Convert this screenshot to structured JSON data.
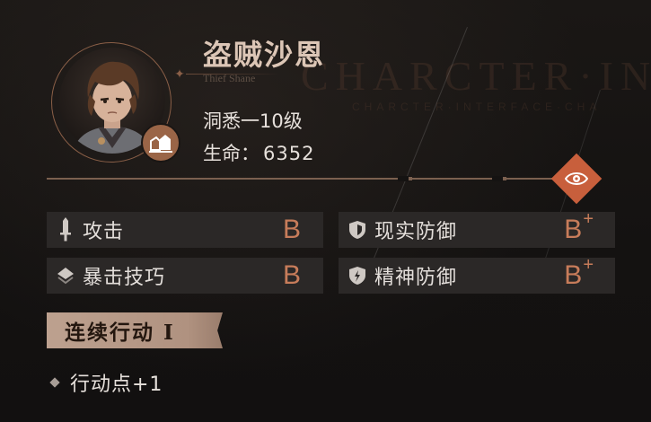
{
  "watermark": {
    "title": "CHARCTER·IN",
    "subtitle": "CHARCTER·INTERFACE·CHA"
  },
  "character": {
    "name": "盗贼沙恩",
    "name_en": "Thief Shane",
    "insight_level": "洞悉一10级",
    "life_label": "生命：",
    "life_value": "6352",
    "class_icon": "thief-class-icon"
  },
  "view_button": {
    "icon": "eye-icon",
    "color": "#c85f3c"
  },
  "stats": [
    {
      "icon": "sword-icon",
      "label": "攻击",
      "grade": "B",
      "plus": ""
    },
    {
      "icon": "shield-icon",
      "label": "现实防御",
      "grade": "B",
      "plus": "+"
    },
    {
      "icon": "diamond-layers-icon",
      "label": "暴击技巧",
      "grade": "B",
      "plus": ""
    },
    {
      "icon": "mind-shield-icon",
      "label": "精神防御",
      "grade": "B",
      "plus": "+"
    }
  ],
  "skill": {
    "title": "连续行动 I",
    "effects": [
      "行动点+1"
    ]
  },
  "colors": {
    "accent": "#c77c5a",
    "panel": "#2b2827",
    "name": "#dcc6b6"
  }
}
